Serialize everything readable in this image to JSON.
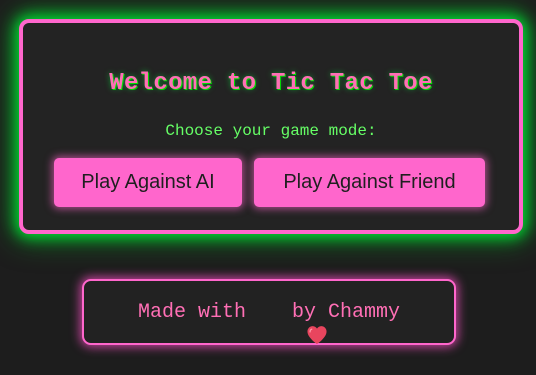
{
  "game_mode_panel": {
    "title": "Welcome to Tic Tac Toe",
    "subtitle": "Choose your game mode:",
    "buttons": {
      "play_ai": "Play Against AI",
      "play_friend": "Play Against Friend"
    }
  },
  "footer": {
    "prefix": "Made with",
    "icon": "heart-icon",
    "suffix": "by Chammy"
  },
  "colors": {
    "accent_pink": "#ff66cc",
    "accent_green": "#00dd33",
    "subtitle_green": "#66ff66",
    "background": "#1d1d1d",
    "panel_background": "#232323"
  }
}
